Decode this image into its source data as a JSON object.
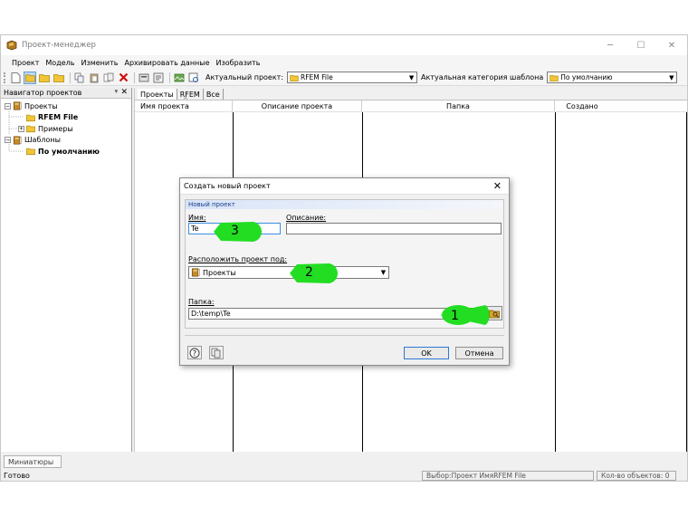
{
  "window": {
    "title": "Проект-менеджер"
  },
  "menu": [
    "Проект",
    "Модель",
    "Изменить",
    "Архивировать данные",
    "Изобразить"
  ],
  "toolbar": {
    "current_project_label": "Актуальный проект:",
    "current_project_value": "RFEM File",
    "template_category_label": "Актуальная категория шаблона",
    "template_category_value": "По умолчанию"
  },
  "navigator": {
    "title": "Навигатор проектов",
    "items": [
      {
        "label": "Проекты"
      },
      {
        "label": "RFEM File"
      },
      {
        "label": "Примеры"
      },
      {
        "label": "Шаблоны"
      },
      {
        "label": "По умолчанию"
      }
    ]
  },
  "tabs": [
    "Проекты",
    "RFEM",
    "Все"
  ],
  "columns": [
    "Имя проекта",
    "Описание проекта",
    "Папка",
    "Создано"
  ],
  "bottom_tab": "Миниатюры",
  "status": {
    "left": "Готово",
    "selection": "Выбор:Проект ИмяRFEM File",
    "count": "Кол-во объектов: 0"
  },
  "dialog": {
    "title": "Создать новый проект",
    "group_title": "Новый проект",
    "name_label": "Имя:",
    "name_value": "Te",
    "description_label": "Описание:",
    "description_value": "",
    "place_under_label": "Расположить проект под:",
    "place_under_value": "Проекты",
    "folder_label": "Папка:",
    "folder_value": "D:\\temp\\Te",
    "ok": "OK",
    "cancel": "Отмена"
  },
  "callouts": [
    "1",
    "2",
    "3"
  ],
  "colors": {
    "callout_green": "#22dd22",
    "focus_blue": "#3b8ee0",
    "folder_yellow": "#f2c537"
  }
}
